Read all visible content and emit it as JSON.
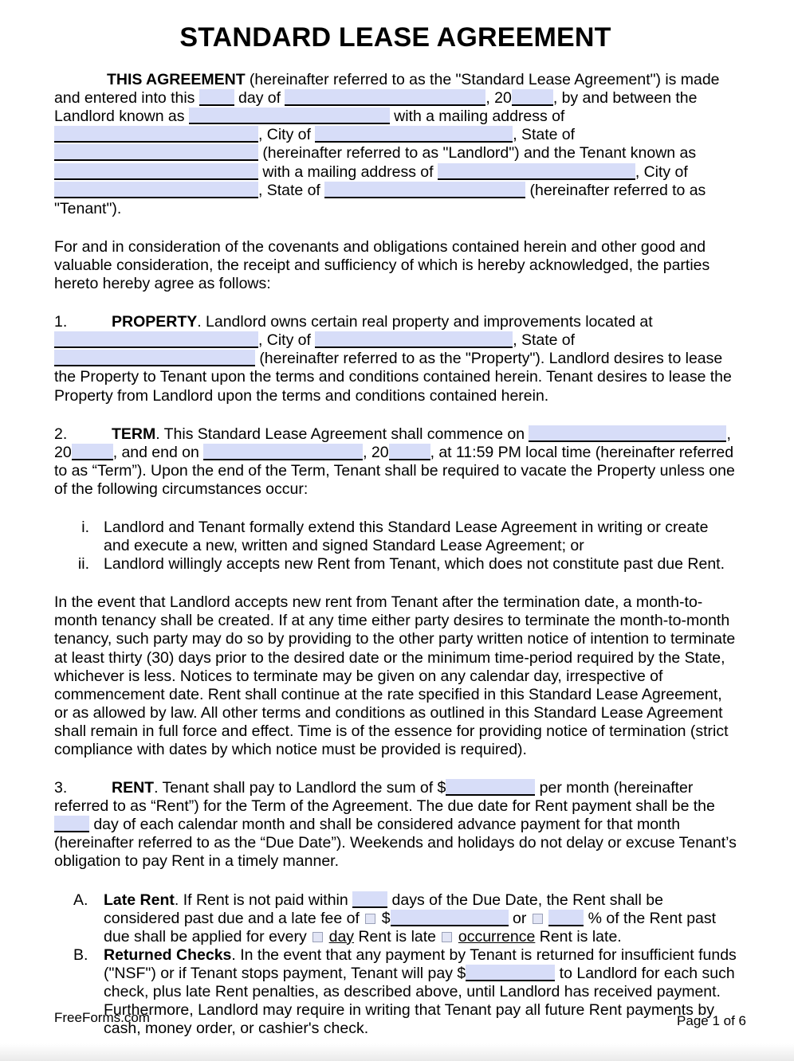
{
  "document": {
    "title": "STANDARD LEASE AGREEMENT",
    "site": "FreeForms.com",
    "page_label": "Page 1 of 6",
    "field_color": "#d7ddf8",
    "checkbox_color": "#e2e5f5",
    "checkbox_border": "#9aa0b8"
  },
  "intro": {
    "lead": "THIS AGREEMENT",
    "t1": " (hereinafter referred to as the \"Standard Lease Agreement\") is made and entered into this ",
    "t2": " day of ",
    "t3": ", 20",
    "t4": ", by and between the Landlord known as ",
    "t5": " with a mailing address of ",
    "t6": ", City of ",
    "t7": ", State of ",
    "t8": " (hereinafter referred to as \"Landlord\") and the Tenant known as ",
    "t9": " with a mailing address of ",
    "t10": ", City of ",
    "t11": ", State of ",
    "t12": " (hereinafter referred to as \"Tenant\")."
  },
  "consideration": {
    "text": "For and in consideration of the covenants and obligations contained herein and other good and valuable consideration, the receipt and sufficiency of which is hereby acknowledged, the parties hereto hereby agree as follows:"
  },
  "sections": {
    "property": {
      "number": "1.",
      "heading": "PROPERTY",
      "t1": ". Landlord owns certain real property and improvements located at ",
      "t2": ", City of ",
      "t3": ", State of ",
      "t4": " (hereinafter referred to as the \"Property\"). Landlord desires to lease the Property to Tenant upon the terms and conditions contained herein. Tenant desires to lease the Property from Landlord upon the terms and conditions contained herein."
    },
    "term": {
      "number": "2.",
      "heading": "TERM",
      "t1": ". This Standard Lease Agreement shall commence on ",
      "t2": ", 20",
      "t3": ", and end on ",
      "t4": ", 20",
      "t5": ", at 11:59 PM local time (hereinafter referred to as “Term”). Upon the end of the Term, Tenant shall be required to vacate the Property unless one of the following circumstances occur:",
      "items": [
        {
          "marker": "i.",
          "text": "Landlord and Tenant formally extend this Standard Lease Agreement in writing or create and execute a new, written and signed Standard Lease Agreement; or"
        },
        {
          "marker": "ii.",
          "text": "Landlord willingly accepts new Rent from Tenant, which does not constitute past due Rent."
        }
      ],
      "month_to_month": "In the event that Landlord accepts new rent from Tenant after the termination date, a month-to-month tenancy shall be created. If at any time either party desires to terminate the month-to-month tenancy, such party may do so by providing to the other party written notice of intention to terminate at least thirty (30) days prior to the desired date or the minimum time-period required by the State, whichever is less. Notices to terminate may be given on any calendar day, irrespective of commencement date. Rent shall continue at the rate specified in this Standard Lease Agreement, or as allowed by law. All other terms and conditions as outlined in this Standard Lease Agreement shall remain in full force and effect. Time is of the essence for providing notice of termination (strict compliance with dates by which notice must be provided is required)."
    },
    "rent": {
      "number": "3.",
      "heading": "RENT",
      "t1": ". Tenant shall pay to Landlord the sum of $",
      "t2": " per month (hereinafter referred to as “Rent”) for the Term of the Agreement. The due date for Rent payment shall be the ",
      "t3": " day of each calendar month and shall be considered advance payment for that month (hereinafter referred to as the “Due Date”). Weekends and holidays do not delay or excuse Tenant’s obligation to pay Rent in a timely manner.",
      "subsections": {
        "late_rent": {
          "marker": "A.",
          "heading": "Late Rent",
          "t1": ". If Rent is not paid within ",
          "t2": " days of the Due Date, the Rent shall be considered past due and a late fee of ",
          "t3": " $",
          "t4": " or ",
          "t5": " ",
          "t6": " % of the Rent past due shall be applied for every ",
          "t7": " ",
          "opt_day": "day",
          "t8": " Rent is late ",
          "opt_occurrence": "occurrence",
          "t9": " Rent is late."
        },
        "returned_checks": {
          "marker": "B.",
          "heading": "Returned Checks",
          "t1": ". In the event that any payment by Tenant is returned for insufficient funds (\"NSF\") or if Tenant stops payment, Tenant will pay $",
          "t2": " to Landlord for each such check, plus late Rent penalties, as described above, until Landlord has received payment. Furthermore, Landlord may require in writing that Tenant pay all future Rent payments by cash, money order, or cashier's check."
        }
      }
    }
  }
}
